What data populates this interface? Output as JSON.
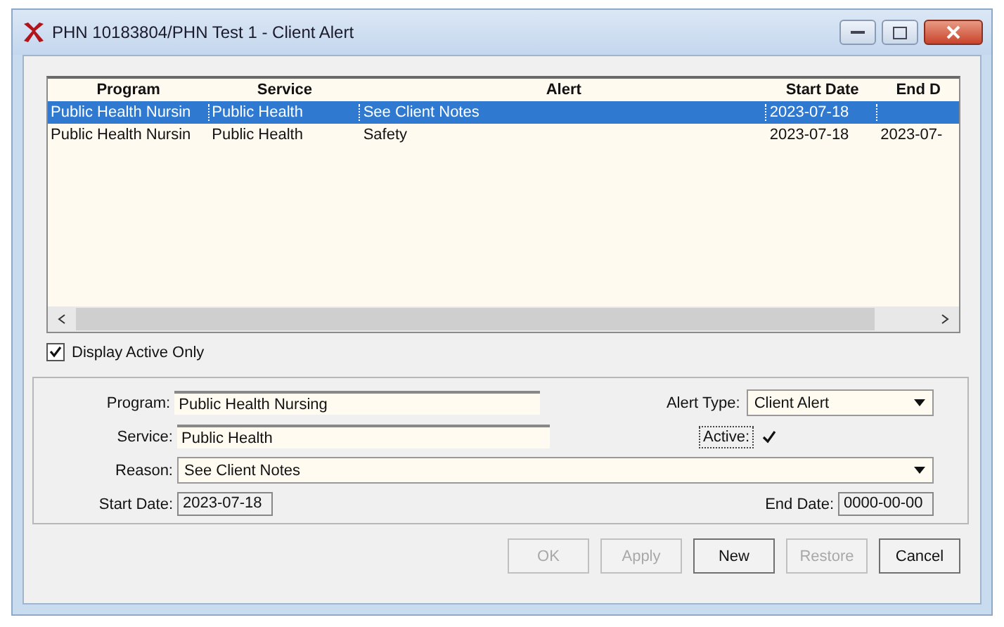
{
  "window": {
    "title": "PHN 10183804/PHN Test 1 - Client Alert"
  },
  "table": {
    "columns": [
      "Program",
      "Service",
      "Alert",
      "Start Date",
      "End D"
    ],
    "rows": [
      {
        "cells": [
          "Public Health Nursin",
          "Public Health",
          "See Client Notes",
          "2023-07-18",
          ""
        ],
        "selected": true
      },
      {
        "cells": [
          "Public Health Nursin",
          "Public Health",
          "Safety",
          "2023-07-18",
          "2023-07-"
        ],
        "selected": false
      }
    ]
  },
  "display_active_only": {
    "label": "Display Active Only",
    "checked": true
  },
  "form": {
    "program": {
      "label": "Program:",
      "value": "Public Health Nursing"
    },
    "service": {
      "label": "Service:",
      "value": "Public Health"
    },
    "reason": {
      "label": "Reason:",
      "value": "See Client Notes"
    },
    "start_date": {
      "label": "Start Date:",
      "value": "2023-07-18"
    },
    "alert_type": {
      "label": "Alert Type:",
      "value": "Client Alert"
    },
    "active": {
      "label": "Active:",
      "checked": true
    },
    "end_date": {
      "label": "End Date:",
      "value": "0000-00-00"
    }
  },
  "buttons": [
    {
      "label": "OK",
      "disabled": true
    },
    {
      "label": "Apply",
      "disabled": true
    },
    {
      "label": "New",
      "disabled": false
    },
    {
      "label": "Restore",
      "disabled": true
    },
    {
      "label": "Cancel",
      "disabled": false
    }
  ]
}
